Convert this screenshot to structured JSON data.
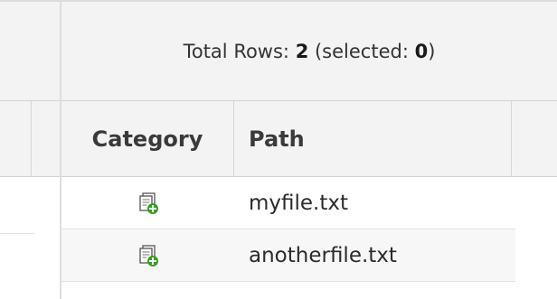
{
  "summary": {
    "total_label": "Total Rows: ",
    "total_count": "2",
    "selected_prefix": " (selected: ",
    "selected_count": "0",
    "selected_suffix": ")"
  },
  "columns": {
    "category": "Category",
    "path": "Path"
  },
  "rows": [
    {
      "category_icon": "file-add-icon",
      "path": "myfile.txt"
    },
    {
      "category_icon": "file-add-icon",
      "path": "anotherfile.txt"
    }
  ],
  "colors": {
    "header_bg": "#f3f3f3",
    "border": "#d6d6d6",
    "icon_green": "#3a9d23"
  }
}
